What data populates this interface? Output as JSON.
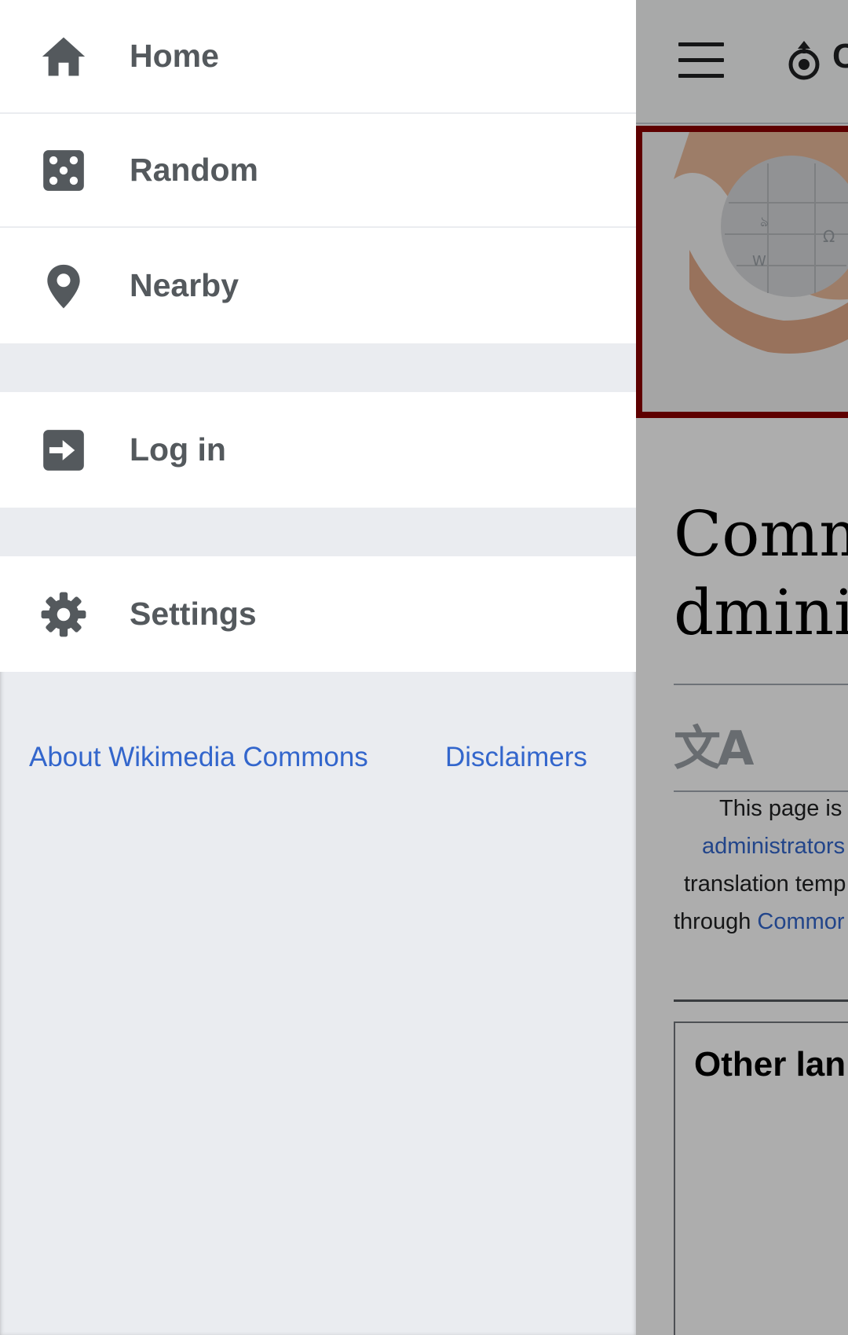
{
  "drawer": {
    "primary_items": [
      {
        "label": "Home",
        "icon": "home-icon"
      },
      {
        "label": "Random",
        "icon": "dice-icon"
      },
      {
        "label": "Nearby",
        "icon": "map-pin-icon"
      }
    ],
    "login": {
      "label": "Log in",
      "icon": "login-icon"
    },
    "settings": {
      "label": "Settings",
      "icon": "gear-icon"
    },
    "footer_links": [
      "About Wikimedia Commons",
      "Disclaimers"
    ]
  },
  "background_page": {
    "title_line1": "Comm",
    "title_line2": "dmini",
    "translate_glyph": "文A",
    "body_line1": "This page is",
    "body_line2_link": "administrators",
    "body_line3": "translation temp",
    "body_line4_text": "through ",
    "body_line4_link": "Commor",
    "other_languages": "Other lan",
    "logo_partial": "C"
  },
  "colors": {
    "drawer_bg": "#eaecf0",
    "item_text": "#54595d",
    "link": "#3366cc",
    "hero_border": "#8b0000"
  }
}
